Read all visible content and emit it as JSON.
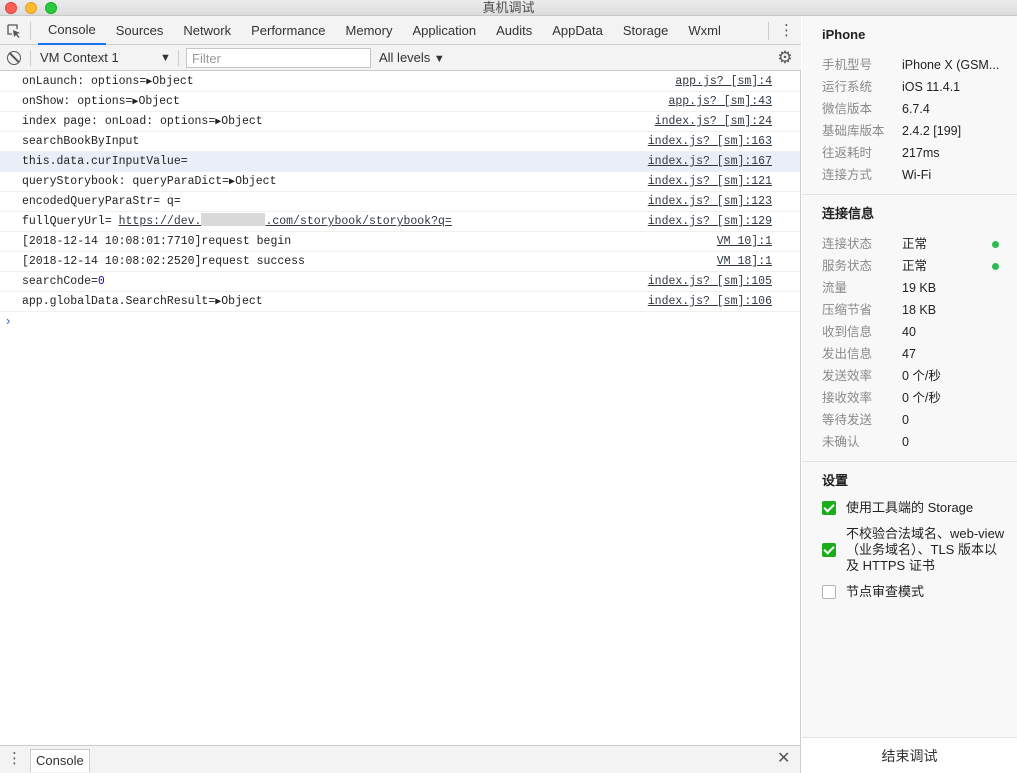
{
  "window": {
    "title": "真机调试"
  },
  "tabs": [
    "Console",
    "Sources",
    "Network",
    "Performance",
    "Memory",
    "Application",
    "Audits",
    "AppData",
    "Storage",
    "Wxml"
  ],
  "active_tab": "Console",
  "toolbar": {
    "context": "VM Context 1",
    "filter_placeholder": "Filter",
    "levels": "All levels"
  },
  "console_rows": [
    {
      "prefix": "onLaunch: options=",
      "obj": "Object",
      "source": "app.js? [sm]:4"
    },
    {
      "prefix": "onShow: options=",
      "obj": "Object",
      "source": "app.js? [sm]:43"
    },
    {
      "prefix": "index page: onLoad: options=",
      "obj": "Object",
      "source": "index.js? [sm]:24"
    },
    {
      "text": "searchBookByInput",
      "source": "index.js? [sm]:163"
    },
    {
      "text": "this.data.curInputValue=",
      "source": "index.js? [sm]:167"
    },
    {
      "prefix": "queryStorybook: queryParaDict=",
      "obj": "Object",
      "source": "index.js? [sm]:121"
    },
    {
      "text": "encodedQueryParaStr= q=",
      "source": "index.js? [sm]:123"
    },
    {
      "url_label": "fullQueryUrl= ",
      "url_start": "https://dev.",
      "url_end": ".com/storybook/storybook?q=",
      "source": "index.js? [sm]:129"
    },
    {
      "text": "[2018-12-14 10:08:01:7710]request begin",
      "source": "VM 10]:1"
    },
    {
      "text": "[2018-12-14 10:08:02:2520]request success",
      "source": "VM 18]:1"
    },
    {
      "num_label": "searchCode=",
      "num": "0",
      "source": "index.js? [sm]:105"
    },
    {
      "prefix": "app.globalData.SearchResult=",
      "obj": "Object",
      "source": "index.js? [sm]:106"
    }
  ],
  "prompt": "›",
  "drawer": {
    "tab": "Console"
  },
  "panel": {
    "device_title": "iPhone",
    "device_info": [
      {
        "key": "手机型号",
        "value": "iPhone X (GSM..."
      },
      {
        "key": "运行系统",
        "value": "iOS 11.4.1"
      },
      {
        "key": "微信版本",
        "value": "6.7.4"
      },
      {
        "key": "基础库版本",
        "value": "2.4.2 [199]"
      },
      {
        "key": "往返耗时",
        "value": "217ms"
      },
      {
        "key": "连接方式",
        "value": "Wi-Fi"
      }
    ],
    "conn_title": "连接信息",
    "conn_info": [
      {
        "key": "连接状态",
        "value": "正常",
        "status": "ok"
      },
      {
        "key": "服务状态",
        "value": "正常",
        "status": "ok"
      },
      {
        "key": "流量",
        "value": "19 KB"
      },
      {
        "key": "压缩节省",
        "value": "18 KB"
      },
      {
        "key": "收到信息",
        "value": "40"
      },
      {
        "key": "发出信息",
        "value": "47"
      },
      {
        "key": "发送效率",
        "value": "0 个/秒"
      },
      {
        "key": "接收效率",
        "value": "0 个/秒"
      },
      {
        "key": "等待发送",
        "value": "0"
      },
      {
        "key": "未确认",
        "value": "0"
      }
    ],
    "settings_title": "设置",
    "settings": [
      {
        "label": "使用工具端的 Storage",
        "checked": true
      },
      {
        "label": "不校验合法域名、web-view（业务域名）、TLS 版本以及 HTTPS 证书",
        "checked": true
      },
      {
        "label": "节点审查模式",
        "checked": false
      }
    ],
    "end_button": "结束调试"
  },
  "colors": {
    "accent": "#1a73e8",
    "status_ok": "#2bbd51",
    "checkbox_on": "#1aad19"
  },
  "icons": [
    "inspect-icon",
    "kebab-icon",
    "clear-console-icon",
    "settings-gear-icon",
    "close-icon"
  ]
}
